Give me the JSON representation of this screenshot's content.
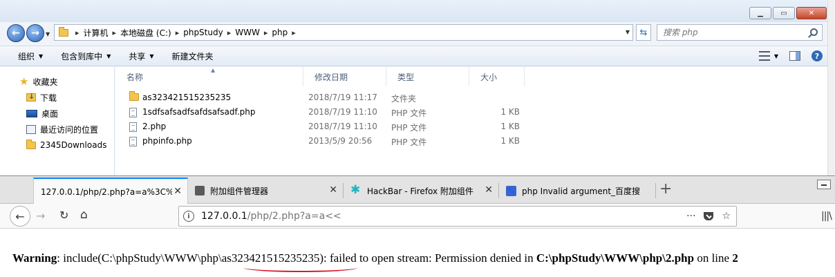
{
  "explorer": {
    "breadcrumbs": [
      "计算机",
      "本地磁盘 (C:)",
      "phpStudy",
      "WWW",
      "php"
    ],
    "search_placeholder": "搜索 php",
    "toolbar": {
      "organize": "组织",
      "include_in_library": "包含到库中",
      "share": "共享",
      "new_folder": "新建文件夹"
    },
    "nav": {
      "favorites": "收藏夹",
      "downloads": "下载",
      "desktop": "桌面",
      "recent": "最近访问的位置",
      "downloads2345": "2345Downloads"
    },
    "columns": {
      "name": "名称",
      "date": "修改日期",
      "type": "类型",
      "size": "大小"
    },
    "files": [
      {
        "name": "as323421515235235",
        "date": "2018/7/19 11:17",
        "type": "文件夹",
        "size": "",
        "icon": "folder-icon"
      },
      {
        "name": "1sdfsafsadfsafdsafsadf.php",
        "date": "2018/7/19 11:10",
        "type": "PHP 文件",
        "size": "1 KB",
        "icon": "php-file-icon"
      },
      {
        "name": "2.php",
        "date": "2018/7/19 11:10",
        "type": "PHP 文件",
        "size": "1 KB",
        "icon": "php-file-icon"
      },
      {
        "name": "phpinfo.php",
        "date": "2013/5/9 20:56",
        "type": "PHP 文件",
        "size": "1 KB",
        "icon": "php-file-icon"
      }
    ]
  },
  "firefox": {
    "tabs": [
      {
        "title": "127.0.0.1/php/2.php?a=a%3C%3",
        "icon": "none",
        "active": true
      },
      {
        "title": "附加组件管理器",
        "icon": "puzzle-icon",
        "active": false
      },
      {
        "title": "HackBar - Firefox 附加组件",
        "icon": "hackbar-icon",
        "active": false
      },
      {
        "title": "php Invalid argument_百度搜",
        "icon": "baidu-icon",
        "active": false
      }
    ],
    "url_host": "127.0.0.1",
    "url_path": "/php/2.php?a=a<<",
    "url_more": "···",
    "warning": {
      "label": "Warning",
      "text1": ": include(C:\\phpStudy\\WWW\\php\\",
      "folder": "as323421515235235",
      "text2": "): failed to open stream: Permission denied in ",
      "file": "C:\\phpStudy\\WWW\\php\\2.php",
      "text3": " on line ",
      "line": "2"
    }
  },
  "colors": {
    "accent_blue": "#0a84ff",
    "annotation_red": "#d71a2a"
  }
}
